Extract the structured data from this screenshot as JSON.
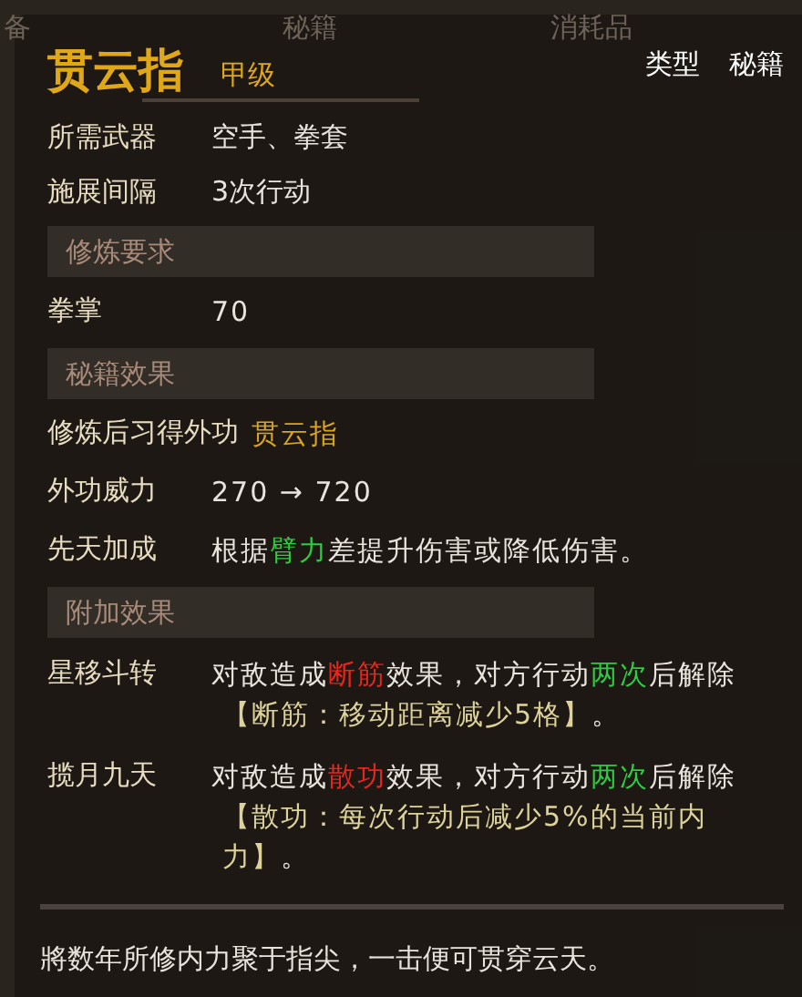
{
  "background_tabs": [
    "备",
    "秘籍",
    "消耗品"
  ],
  "title": "贯云指",
  "grade": "甲级",
  "type_label": "类型",
  "type_value": "秘籍",
  "basic_rows": [
    {
      "label": "所需武器",
      "value": "空手、拳套"
    },
    {
      "label": "施展间隔",
      "value": "3次行动"
    }
  ],
  "sections": [
    {
      "header": "修炼要求",
      "rows": [
        {
          "label": "拳掌",
          "segments": [
            {
              "text": "70",
              "color": "#e8e4dc"
            }
          ]
        }
      ]
    },
    {
      "header": "秘籍效果",
      "rows": [
        {
          "label": "修炼后习得外功",
          "segments": [
            {
              "text": "贯云指",
              "color": "#d9a520"
            }
          ]
        },
        {
          "label": "外功威力",
          "segments": [
            {
              "text": "270 → 720",
              "color": "#e8e4dc"
            }
          ]
        },
        {
          "label": "先天加成",
          "segments": [
            {
              "text": "根据",
              "color": "#e8e4dc"
            },
            {
              "text": "臂力",
              "color": "#2ecc40"
            },
            {
              "text": "差提升伤害或降低伤害。",
              "color": "#e8e4dc"
            }
          ]
        }
      ]
    },
    {
      "header": "附加效果",
      "rows": [
        {
          "label": "星移斗转",
          "segments": [
            {
              "text": "对敌造成",
              "color": "#e8e4dc"
            },
            {
              "text": "断筋",
              "color": "#e8261e"
            },
            {
              "text": "效果，对方行动",
              "color": "#e8e4dc"
            },
            {
              "text": "两次",
              "color": "#2ecc40"
            },
            {
              "text": "后解除",
              "color": "#e8e4dc"
            }
          ],
          "note": "【断筋：移动距离减少5格】",
          "note_end": "。"
        },
        {
          "label": "揽月九天",
          "segments": [
            {
              "text": "对敌造成",
              "color": "#e8e4dc"
            },
            {
              "text": "散功",
              "color": "#e8261e"
            },
            {
              "text": "效果，对方行动",
              "color": "#e8e4dc"
            },
            {
              "text": "两次",
              "color": "#2ecc40"
            },
            {
              "text": "后解除",
              "color": "#e8e4dc"
            }
          ],
          "note": "【散功：每次行动后减少5%的当前内力】",
          "note_end": "。"
        }
      ]
    }
  ],
  "flavor": "將数年所修内力聚于指尖，一击便可贯穿云天。"
}
